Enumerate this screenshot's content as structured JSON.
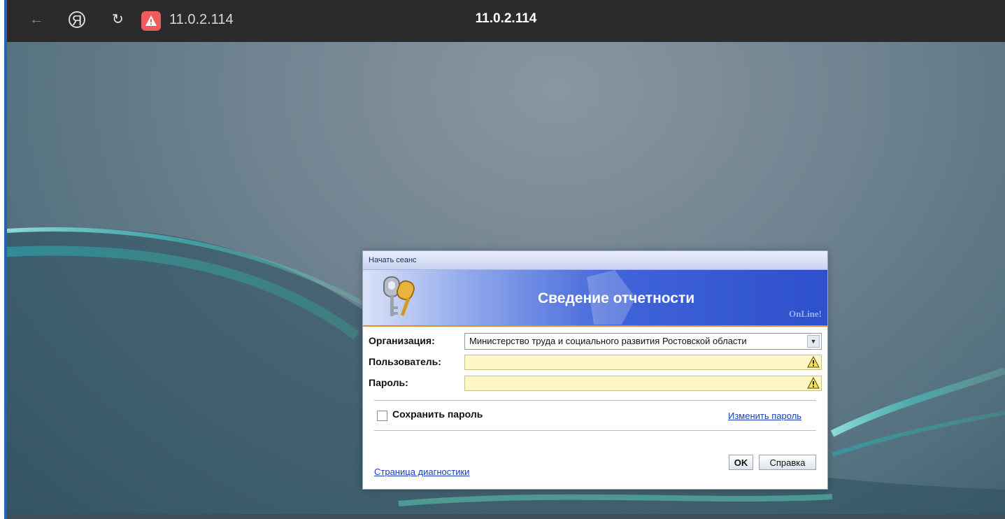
{
  "browser": {
    "url": "11.0.2.114",
    "title": "11.0.2.114",
    "icons": [
      "back-arrow-icon",
      "yandex-icon",
      "reload-icon",
      "warning-icon"
    ]
  },
  "dialog": {
    "title": "Начать сеанс",
    "banner_title": "Сведение отчетности",
    "banner_subtitle": "OnLine!",
    "organization_label": "Организация:",
    "organization_value": "Министерство труда и социального развития Ростовской области",
    "user_label": "Пользователь:",
    "user_value": "",
    "password_label": "Пароль:",
    "password_value": "",
    "save_password_label": "Сохранить пароль",
    "save_password_checked": false,
    "change_password_link": "Изменить пароль",
    "diagnostics_link": "Страница диагностики",
    "ok_button": "OK",
    "help_button": "Справка"
  },
  "colors": {
    "banner": "#2d50cc",
    "field_required": "#fff8c5",
    "link": "#1a3db8",
    "browser_bar": "#2b2b2d"
  }
}
